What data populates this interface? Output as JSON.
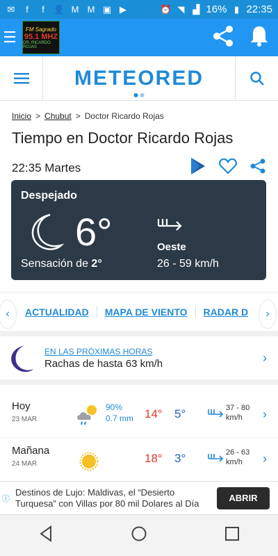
{
  "statusbar": {
    "battery": "16%",
    "time": "22:35"
  },
  "appbar": {
    "logo_line1": "FM Sagrado",
    "logo_line2": "95.1 MHZ",
    "logo_line3": "DR. RICARDO ROJAS"
  },
  "header": {
    "brand": "METEORED"
  },
  "breadcrumb": {
    "home": "Inicio",
    "sep1": ">",
    "region": "Chubut",
    "sep2": ">",
    "current": "Doctor Ricardo Rojas"
  },
  "page": {
    "title": "Tiempo en Doctor Ricardo Rojas",
    "datetime": "22:35 Martes"
  },
  "current": {
    "condition": "Despejado",
    "temp": "6°",
    "feels_label": "Sensación de",
    "feels_value": "2°",
    "wind_dir": "Oeste",
    "wind_speed": "26 - 59 km/h"
  },
  "tabs": [
    "ACTUALIDAD",
    "MAPA DE VIENTO",
    "RADAR D"
  ],
  "alert": {
    "label": "EN LAS PRÓXIMAS HORAS",
    "text": "Rachas de hasta 63 km/h"
  },
  "forecast": [
    {
      "name": "Hoy",
      "date": "23 MAR",
      "icon": "cloud-rain-sun-icon",
      "precip_prob": "90%",
      "precip_mm": "0.7 mm",
      "tmax": "14°",
      "tmin": "5°",
      "wind": "37 - 80",
      "wind_unit": "km/h"
    },
    {
      "name": "Mañana",
      "date": "24 MAR",
      "icon": "sun-icon",
      "precip_prob": "",
      "precip_mm": "",
      "tmax": "18°",
      "tmin": "3°",
      "wind": "26 - 63",
      "wind_unit": "km/h"
    }
  ],
  "ad": {
    "text": "Destinos de Lujo: Maldivas, el “Desierto Turquesa” con Villas por 80 mil Dolares al Día",
    "button": "ABRIR"
  }
}
